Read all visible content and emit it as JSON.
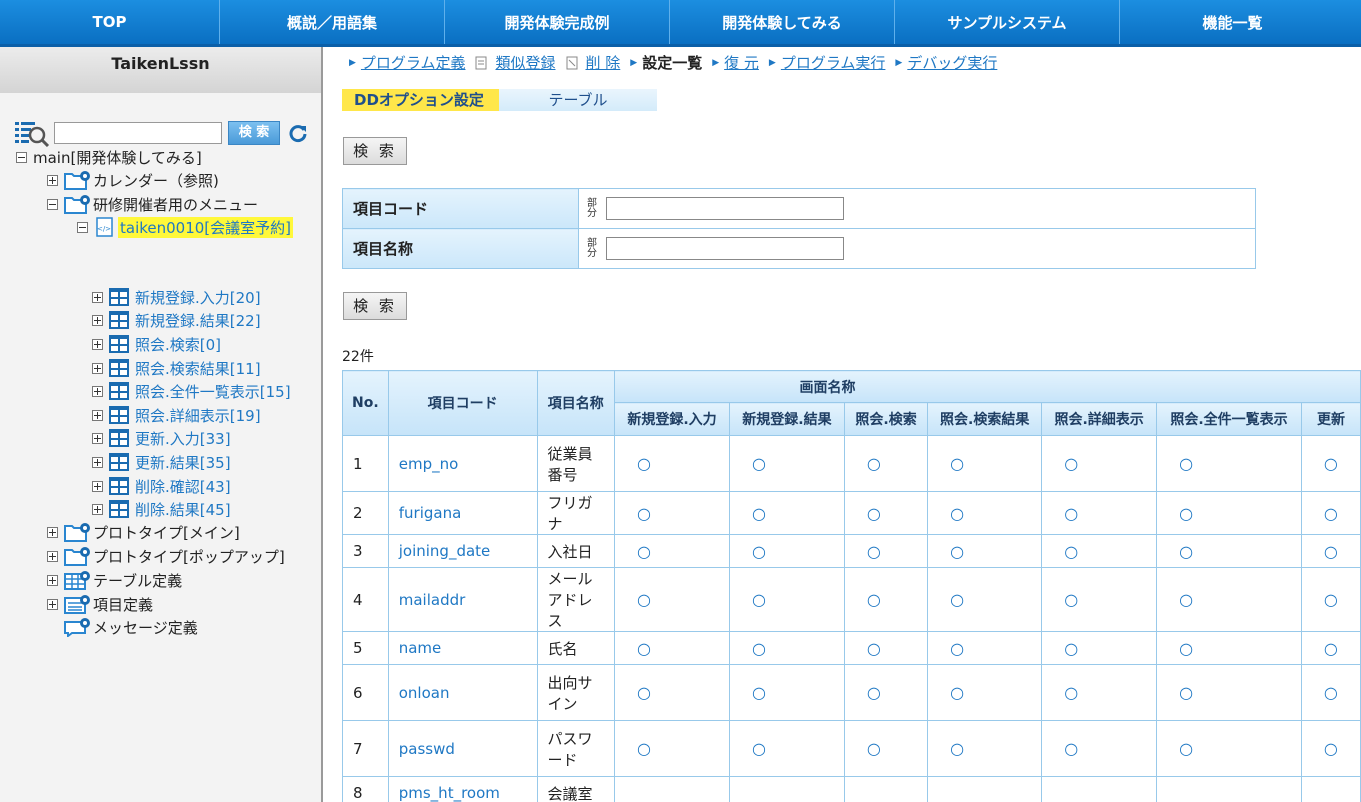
{
  "topnav": [
    "TOP",
    "概説／用語集",
    "開発体験完成例",
    "開発体験してみる",
    "サンプルシステム",
    "機能一覧"
  ],
  "sidebar": {
    "title": "TaikenLssn",
    "search_button": "検 索",
    "tree": [
      {
        "label": "main[開発体験してみる]"
      },
      {
        "label": "カレンダー（参照)"
      },
      {
        "label": "研修開催者用のメニュー"
      },
      {
        "label": "taiken0010[会議室予約]"
      },
      {
        "label": "新規登録.入力[20]"
      },
      {
        "label": "新規登録.結果[22]"
      },
      {
        "label": "照会.検索[0]"
      },
      {
        "label": "照会.検索結果[11]"
      },
      {
        "label": "照会.全件一覧表示[15]"
      },
      {
        "label": "照会.詳細表示[19]"
      },
      {
        "label": "更新.入力[33]"
      },
      {
        "label": "更新.結果[35]"
      },
      {
        "label": "削除.確認[43]"
      },
      {
        "label": "削除.結果[45]"
      },
      {
        "label": "プロトタイプ[メイン]"
      },
      {
        "label": "プロトタイプ[ポップアップ]"
      },
      {
        "label": "テーブル定義"
      },
      {
        "label": "項目定義"
      },
      {
        "label": "メッセージ定義"
      }
    ]
  },
  "crumbs": {
    "program_def": "プログラム定義",
    "similar": "類似登録",
    "delete": "削 除",
    "settings_list": "設定一覧",
    "restore": "復 元",
    "run": "プログラム実行",
    "debug": "デバッグ実行"
  },
  "tabs": {
    "dd_option": "DDオプション設定",
    "table": "テーブル"
  },
  "search_button": "検 索",
  "conditions": {
    "item_code_label": "項目コード",
    "item_name_label": "項目名称",
    "partial": "部分"
  },
  "count": "22件",
  "list": {
    "headers": {
      "no": "No.",
      "code": "項目コード",
      "name": "項目名称",
      "screen_group": "画面名称",
      "screens": [
        "新規登録.入力",
        "新規登録.結果",
        "照会.検索",
        "照会.検索結果",
        "照会.詳細表示",
        "照会.全件一覧表示",
        "更新"
      ]
    },
    "rows": [
      {
        "no": "1",
        "code": "emp_no",
        "name": "従業員番号",
        "marks": [
          "○",
          "○",
          "○",
          "○",
          "○",
          "○",
          "○"
        ]
      },
      {
        "no": "2",
        "code": "furigana",
        "name": "フリガナ",
        "marks": [
          "○",
          "○",
          "○",
          "○",
          "○",
          "○",
          "○"
        ]
      },
      {
        "no": "3",
        "code": "joining_date",
        "name": "入社日",
        "marks": [
          "○",
          "○",
          "○",
          "○",
          "○",
          "○",
          "○"
        ]
      },
      {
        "no": "4",
        "code": "mailaddr",
        "name": "メールアドレス",
        "marks": [
          "○",
          "○",
          "○",
          "○",
          "○",
          "○",
          "○"
        ]
      },
      {
        "no": "5",
        "code": "name",
        "name": "氏名",
        "marks": [
          "○",
          "○",
          "○",
          "○",
          "○",
          "○",
          "○"
        ]
      },
      {
        "no": "6",
        "code": "onloan",
        "name": "出向サイン",
        "marks": [
          "○",
          "○",
          "○",
          "○",
          "○",
          "○",
          "○"
        ]
      },
      {
        "no": "7",
        "code": "passwd",
        "name": "パスワード",
        "marks": [
          "○",
          "○",
          "○",
          "○",
          "○",
          "○",
          "○"
        ]
      },
      {
        "no": "8",
        "code": "pms_ht_room",
        "name": "会議室",
        "marks": [
          "",
          "",
          "",
          "",
          "",
          "",
          ""
        ]
      }
    ]
  }
}
